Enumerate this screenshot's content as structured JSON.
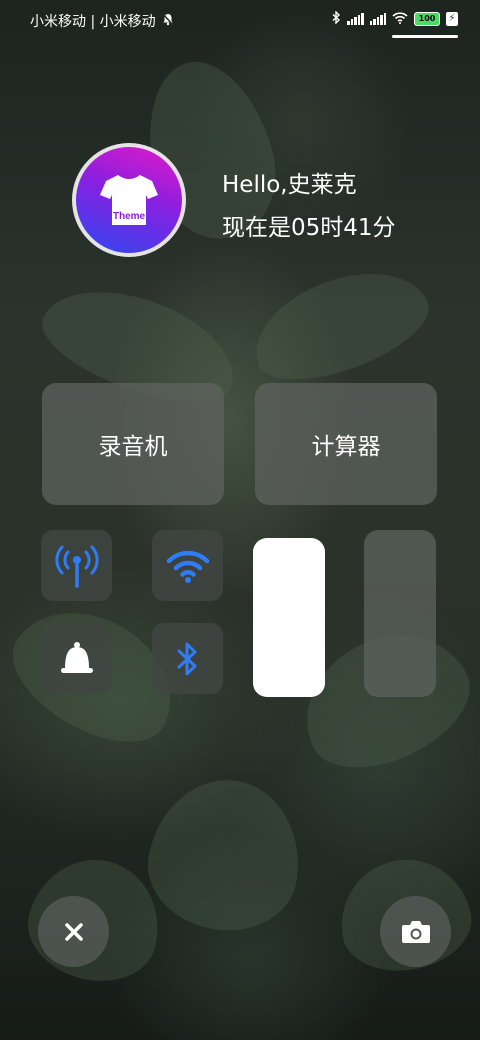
{
  "status_bar": {
    "carrier": "小米移动 | 小米移动",
    "battery": "100",
    "icons": [
      "mute-bell-icon",
      "bluetooth-icon",
      "signal-icon",
      "signal-icon",
      "wifi-icon",
      "battery-icon",
      "charging-icon"
    ]
  },
  "profile": {
    "avatar_label": "Theme",
    "greeting": "Hello,史莱克",
    "time_text": "现在是05时41分"
  },
  "shortcuts": {
    "recorder": "录音机",
    "calculator": "计算器"
  },
  "toggles": [
    {
      "name": "mobile-data",
      "icon": "antenna-icon",
      "active": true
    },
    {
      "name": "wifi",
      "icon": "wifi-icon",
      "active": true
    },
    {
      "name": "ring",
      "icon": "bell-icon",
      "active": false
    },
    {
      "name": "bluetooth",
      "icon": "bluetooth-icon",
      "active": true
    }
  ],
  "sliders": {
    "brightness_level": 1.0,
    "volume_level": 0.0
  },
  "bottom": {
    "close_icon": "close-icon",
    "camera_icon": "camera-icon"
  },
  "colors": {
    "accent_blue": "#2f7df6",
    "avatar_gradient": [
      "#e21bc7",
      "#2c49f0"
    ],
    "battery_green": "#4cd964"
  }
}
